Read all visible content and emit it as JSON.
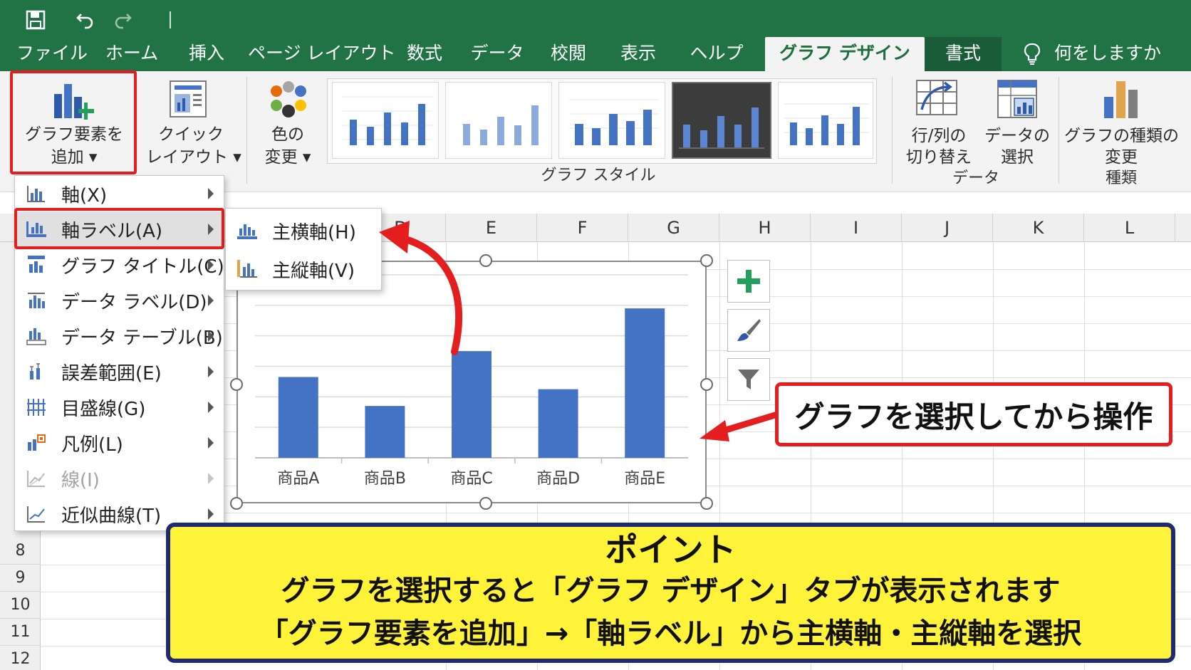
{
  "tabs": {
    "file": "ファイル",
    "home": "ホーム",
    "insert": "挿入",
    "page_layout": "ページ レイアウト",
    "formulas": "数式",
    "data": "データ",
    "review": "校閲",
    "view": "表示",
    "help": "ヘルプ",
    "chart_design": "グラフ デザイン",
    "format": "書式",
    "tell_me": "何をしますか"
  },
  "ribbon": {
    "add_element_line1": "グラフ要素を",
    "add_element_line2": "追加 ▾",
    "quick_layout_line1": "クイック",
    "quick_layout_line2": "レイアウト ▾",
    "change_color_line1": "色の",
    "change_color_line2": "変更 ▾",
    "chart_styles_label": "グラフ スタイル",
    "switch_row_col_line1": "行/列の",
    "switch_row_col_line2": "切り替え",
    "select_data_line1": "データの",
    "select_data_line2": "選択",
    "data_group_label": "データ",
    "change_type_line1": "グラフの種類の",
    "change_type_line2": "変更",
    "type_group_label": "種類"
  },
  "columns": [
    "D",
    "E",
    "F",
    "G",
    "H",
    "I",
    "J",
    "K",
    "L"
  ],
  "rows": [
    "8",
    "9",
    "10",
    "11",
    "12"
  ],
  "menu": [
    {
      "label": "軸(X)",
      "icon": "axes-icon",
      "disabled": false
    },
    {
      "label": "軸ラベル(A)",
      "icon": "axis-titles-icon",
      "disabled": false
    },
    {
      "label": "グラフ タイトル(C)",
      "icon": "chart-title-icon",
      "disabled": false
    },
    {
      "label": "データ ラベル(D)",
      "icon": "data-labels-icon",
      "disabled": false
    },
    {
      "label": "データ テーブル(B)",
      "icon": "data-table-icon",
      "disabled": false
    },
    {
      "label": "誤差範囲(E)",
      "icon": "error-bars-icon",
      "disabled": false
    },
    {
      "label": "目盛線(G)",
      "icon": "gridlines-icon",
      "disabled": false
    },
    {
      "label": "凡例(L)",
      "icon": "legend-icon",
      "disabled": false
    },
    {
      "label": "線(I)",
      "icon": "lines-icon",
      "disabled": true
    },
    {
      "label": "近似曲線(T)",
      "icon": "trendline-icon",
      "disabled": false
    }
  ],
  "submenu": [
    {
      "label": "主横軸(H)",
      "icon": "primary-horizontal-icon"
    },
    {
      "label": "主縦軸(V)",
      "icon": "primary-vertical-icon"
    }
  ],
  "chart_data": {
    "type": "bar",
    "categories": [
      "商品A",
      "商品B",
      "商品C",
      "商品D",
      "商品E"
    ],
    "values": [
      53,
      34,
      70,
      45,
      98
    ],
    "ylim": [
      0,
      120
    ],
    "grid": true,
    "bar_color": "#4472c4",
    "title": "",
    "xlabel": "",
    "ylabel": ""
  },
  "callout": {
    "text": "グラフを選択してから操作"
  },
  "point": {
    "title": "ポイント",
    "line1": "グラフを選択すると「グラフ デザイン」タブが表示されます",
    "line2": "「グラフ要素を追加」→「軸ラベル」から主横軸・主縦軸を選択"
  },
  "colors": {
    "excel_green": "#217346",
    "highlight_red": "#e41e1e",
    "note_yellow": "#fff33a",
    "note_border": "#1f2a72"
  }
}
